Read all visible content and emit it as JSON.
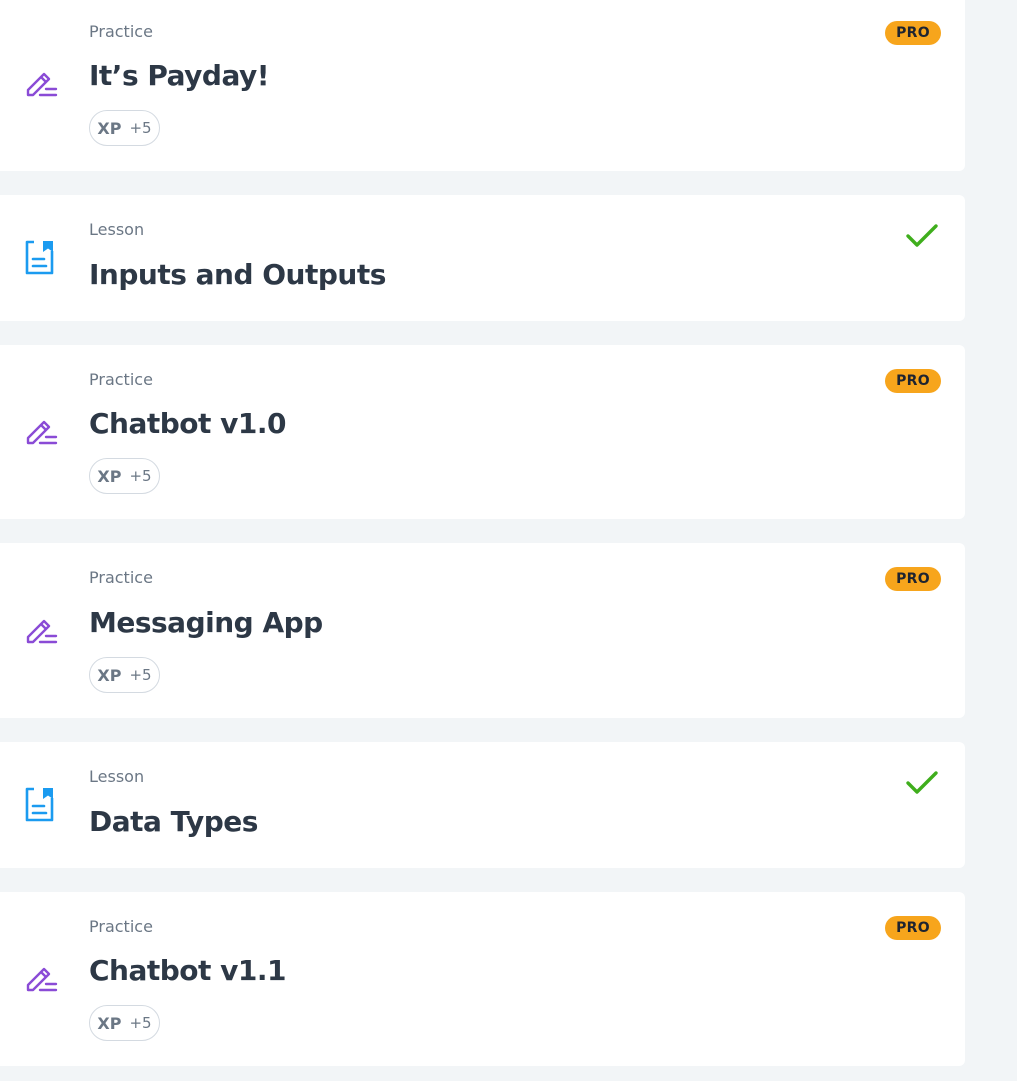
{
  "items": [
    {
      "type": "Practice",
      "title": "It’s Payday!",
      "xp_label": "XP",
      "xp_value": "+5",
      "badge": "PRO",
      "icon": "pencil-icon",
      "completed": false
    },
    {
      "type": "Lesson",
      "title": "Inputs and Outputs",
      "icon": "lesson-doc-icon",
      "completed": true
    },
    {
      "type": "Practice",
      "title": "Chatbot v1.0",
      "xp_label": "XP",
      "xp_value": "+5",
      "badge": "PRO",
      "icon": "pencil-icon",
      "completed": false
    },
    {
      "type": "Practice",
      "title": "Messaging App",
      "xp_label": "XP",
      "xp_value": "+5",
      "badge": "PRO",
      "icon": "pencil-icon",
      "completed": false
    },
    {
      "type": "Lesson",
      "title": "Data Types",
      "icon": "lesson-doc-icon",
      "completed": true
    },
    {
      "type": "Practice",
      "title": "Chatbot v1.1",
      "xp_label": "XP",
      "xp_value": "+5",
      "badge": "PRO",
      "icon": "pencil-icon",
      "completed": false
    }
  ],
  "colors": {
    "background": "#f2f5f7",
    "card": "#ffffff",
    "practice_icon": "#8a4bd6",
    "lesson_icon": "#1b9bf0",
    "pro_badge": "#f7a51c",
    "check": "#3fae1c",
    "title_text": "#2d3846",
    "muted_text": "#6b7785"
  }
}
